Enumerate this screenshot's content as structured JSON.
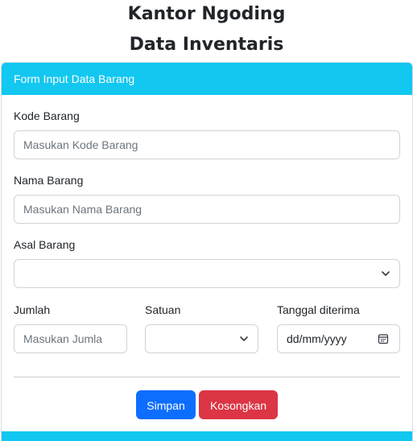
{
  "header": {
    "title": "Kantor Ngoding",
    "subtitle": "Data Inventaris"
  },
  "form": {
    "card_title": "Form Input Data Barang",
    "kode": {
      "label": "Kode Barang",
      "placeholder": "Masukan Kode Barang",
      "value": ""
    },
    "nama": {
      "label": "Nama Barang",
      "placeholder": "Masukan Nama Barang",
      "value": ""
    },
    "asal": {
      "label": "Asal Barang",
      "selected": ""
    },
    "jumlah": {
      "label": "Jumlah",
      "placeholder": "Masukan Jumla",
      "value": ""
    },
    "satuan": {
      "label": "Satuan",
      "selected": ""
    },
    "tanggal": {
      "label": "Tanggal diterima",
      "placeholder": "dd/mm/yyyy",
      "value": ""
    },
    "buttons": {
      "save_label": "Simpan",
      "clear_label": "Kosongkan"
    }
  },
  "colors": {
    "card_header": "#12c7f0",
    "primary": "#0d6efd",
    "danger": "#dc3545"
  },
  "icons": {
    "select": "chevron-down-icon",
    "date": "calendar-icon"
  }
}
